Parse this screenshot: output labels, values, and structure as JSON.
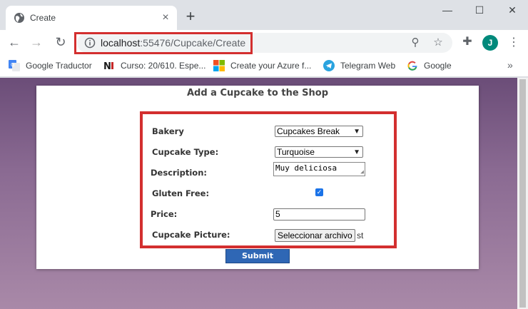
{
  "browser": {
    "tab_title": "Create",
    "url_host": "localhost",
    "url_rest": ":55476/Cupcake/Create",
    "avatar_letter": "J",
    "icons": [
      "globe-icon",
      "close-icon",
      "plus-icon",
      "minimize-icon",
      "maximize-icon",
      "close-window-icon",
      "back-arrow-icon",
      "forward-arrow-icon",
      "reload-icon",
      "info-icon",
      "zoom-icon",
      "star-icon",
      "puzzle-icon",
      "more-vert-icon"
    ],
    "colors": {
      "highlight": "#d32f2f",
      "avatar": "#00897b",
      "submit": "#2f67b5"
    }
  },
  "bookmarks": [
    {
      "label": "Google Traductor",
      "icon": "google-translate-icon"
    },
    {
      "label": "Curso: 20/610. Espe...",
      "icon": "ni-icon"
    },
    {
      "label": "Create your Azure f...",
      "icon": "microsoft-icon"
    },
    {
      "label": "Telegram Web",
      "icon": "telegram-icon"
    },
    {
      "label": "Google",
      "icon": "google-icon"
    }
  ],
  "page": {
    "title": "Add a Cupcake to the Shop",
    "fields": {
      "bakery_label": "Bakery",
      "bakery_value": "Cupcakes Break",
      "type_label": "Cupcake Type:",
      "type_value": "Turquoise",
      "description_label": "Description:",
      "description_value": "Muy deliciosa",
      "gluten_label": "Gluten Free:",
      "gluten_checked": true,
      "price_label": "Price:",
      "price_value": "5",
      "picture_label": "Cupcake Picture:",
      "picture_button": "Seleccionar archivo",
      "picture_status": "st"
    },
    "submit_label": "Submit"
  }
}
